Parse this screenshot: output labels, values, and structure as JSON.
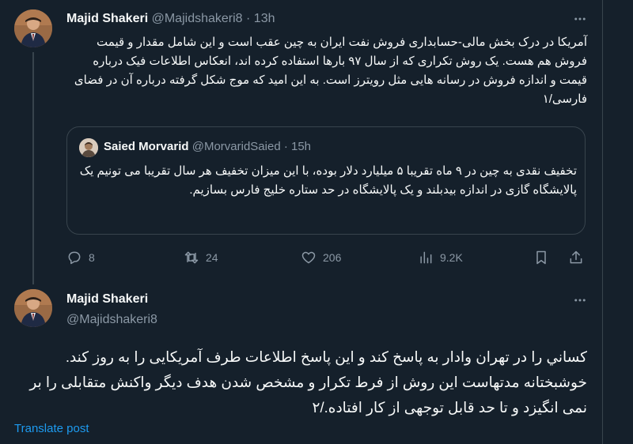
{
  "tweet1": {
    "author_name": "Majid Shakeri",
    "handle": "@Majidshakeri8",
    "time": "13h",
    "text": "آمریکا در درک بخش مالی-حسابداری فروش نفت ایران به چین عقب است و این شامل مقدار و قیمت فروش هم هست. یک روش تکراری که از سال ۹۷ بارها استفاده کرده اند، انعکاس اطلاعات فیک درباره قیمت و اندازه فروش در رسانه هایی مثل رویترز است. به این امید که موج شکل گرفته درباره آن در فضای فارسی/۱",
    "quote": {
      "author_name": "Saied Morvarid",
      "handle": "@MorvaridSaied",
      "time": "15h",
      "text": "تخفیف نقدی به چین در ۹ ماه تقریبا ۵ میلیارد دلار بوده، با این میزان تخفیف هر سال تقریبا می تونیم یک پالایشگاه گازی در اندازه بیدبلند و یک پالایشگاه در حد ستاره خلیج فارس بسازیم."
    },
    "stats": {
      "replies": "8",
      "retweets": "24",
      "likes": "206",
      "views": "9.2K"
    }
  },
  "tweet2": {
    "author_name": "Majid Shakeri",
    "handle": "@Majidshakeri8",
    "text": "کساني را در تهران وادار به پاسخ کند و این پاسخ اطلاعات طرف آمریکایی را به روز کند. خوشبختانه مدتهاست این روش از فرط تکرار و  مشخص شدن هدف دیگر واکنش متقابلی را بر نمی انگیزد و تا حد قابل توجهی از کار افتاده./۲",
    "translate_label": "Translate post"
  },
  "colors": {
    "background": "#15202b",
    "text": "#f7f9f9",
    "muted": "#8b98a5",
    "border": "#38444d",
    "link": "#1d9bf0"
  },
  "icons": [
    "more-icon",
    "reply-icon",
    "retweet-icon",
    "like-icon",
    "views-icon",
    "bookmark-icon",
    "share-icon"
  ]
}
